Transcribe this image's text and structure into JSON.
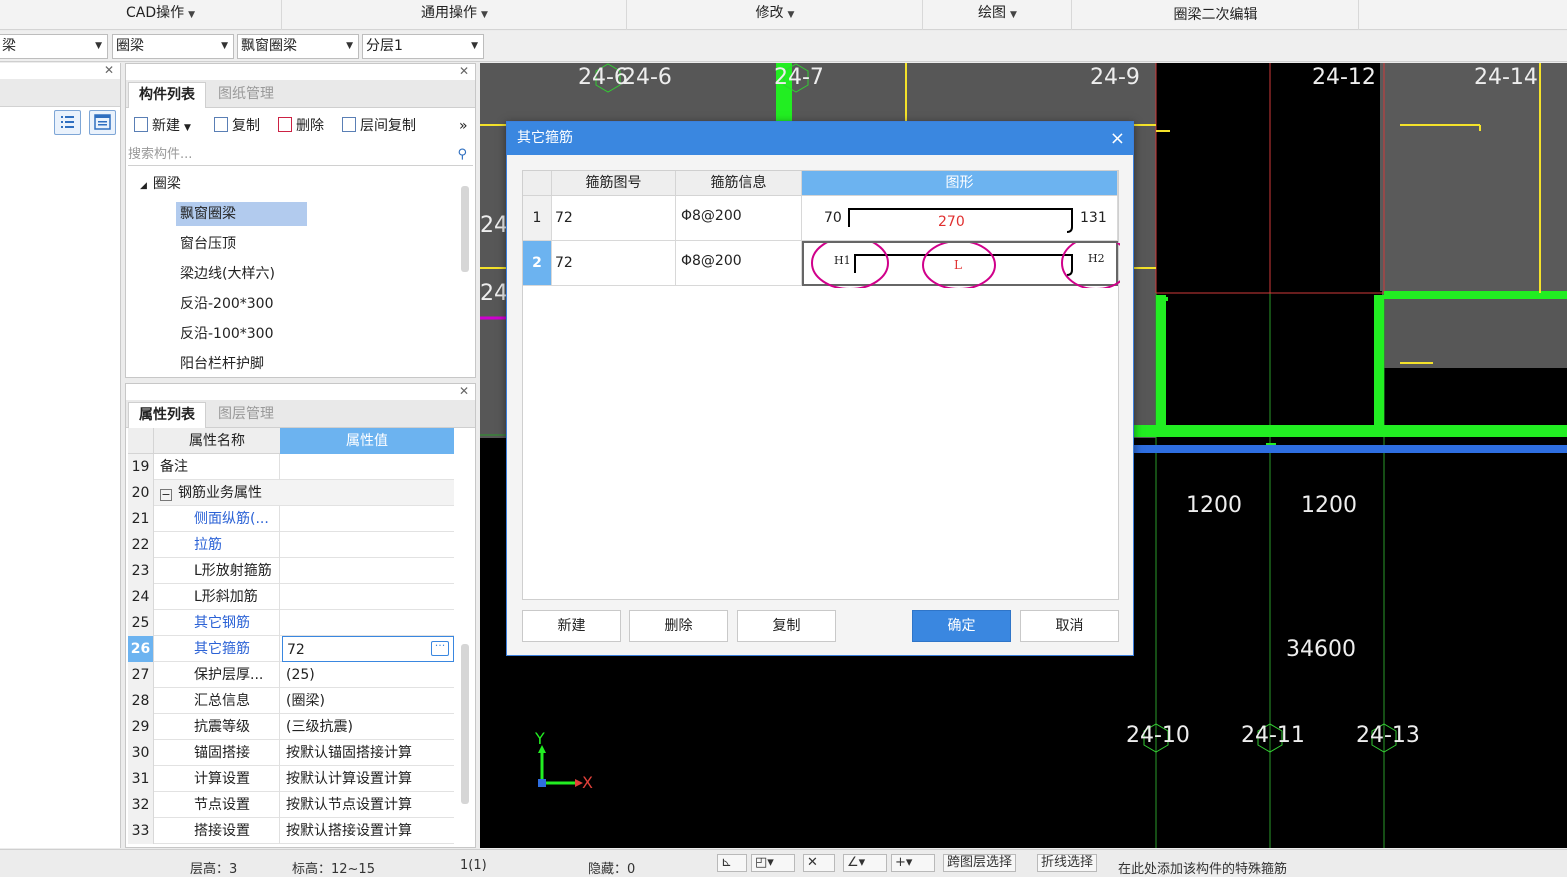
{
  "menubar": {
    "items": [
      "CAD操作",
      "通用操作",
      "修改",
      "绘图",
      "圈梁二次编辑"
    ]
  },
  "combos": {
    "c0": "梁",
    "c1": "圈梁",
    "c2": "飘窗圈梁",
    "c3": "分层1"
  },
  "component_panel": {
    "tabs": [
      "构件列表",
      "图纸管理"
    ],
    "toolbar": {
      "new": "新建",
      "copy": "复制",
      "delete": "删除",
      "floor_copy": "层间复制",
      "more": "»"
    },
    "search_placeholder": "搜索构件...",
    "tree_root": "圈梁",
    "tree_items": [
      "飘窗圈梁",
      "窗台压顶",
      "梁边线(大样六)",
      "反沿-200*300",
      "反沿-100*300",
      "阳台栏杆护脚"
    ]
  },
  "property_panel": {
    "tabs": [
      "属性列表",
      "图层管理"
    ],
    "col_name": "属性名称",
    "col_value": "属性值",
    "rows": [
      {
        "num": "19",
        "name": "备注",
        "value": ""
      },
      {
        "num": "20",
        "name": "钢筋业务属性",
        "value": ""
      },
      {
        "num": "21",
        "name": "侧面纵筋(...",
        "value": ""
      },
      {
        "num": "22",
        "name": "拉筋",
        "value": ""
      },
      {
        "num": "23",
        "name": "L形放射箍筋",
        "value": ""
      },
      {
        "num": "24",
        "name": "L形斜加筋",
        "value": ""
      },
      {
        "num": "25",
        "name": "其它钢筋",
        "value": ""
      },
      {
        "num": "26",
        "name": "其它箍筋",
        "value": "72"
      },
      {
        "num": "27",
        "name": "保护层厚...",
        "value": "(25)"
      },
      {
        "num": "28",
        "name": "汇总信息",
        "value": "(圈梁)"
      },
      {
        "num": "29",
        "name": "抗震等级",
        "value": "(三级抗震)"
      },
      {
        "num": "30",
        "name": "锚固搭接",
        "value": "按默认锚固搭接计算"
      },
      {
        "num": "31",
        "name": "计算设置",
        "value": "按默认计算设置计算"
      },
      {
        "num": "32",
        "name": "节点设置",
        "value": "按默认节点设置计算"
      },
      {
        "num": "33",
        "name": "搭接设置",
        "value": "按默认搭接设置计算"
      }
    ]
  },
  "canvas": {
    "axis_top": [
      "24-6",
      "24-6",
      "24-7",
      "24-9",
      "24-12",
      "24-14"
    ],
    "axis_left": [
      "24",
      "24"
    ],
    "dims": [
      "1200",
      "1200",
      "34600"
    ],
    "axis_bottom": [
      "24-10",
      "24-11",
      "24-13"
    ],
    "ucs_x": "X",
    "ucs_y": "Y"
  },
  "dialog": {
    "title": "其它箍筋",
    "close": "×",
    "headers": [
      "箍筋图号",
      "箍筋信息",
      "图形"
    ],
    "rows": [
      {
        "num": "1",
        "code": "72",
        "info": "Φ8@200",
        "left": "70",
        "middle": "270",
        "right": "131"
      },
      {
        "num": "2",
        "code": "72",
        "info": "Φ8@200",
        "left": "H1",
        "middle": "L",
        "right": "H2"
      }
    ],
    "buttons": {
      "new": "新建",
      "delete": "删除",
      "copy": "复制",
      "ok": "确定",
      "cancel": "取消"
    }
  },
  "statusbar": {
    "floor": "层高：3",
    "elevation": "标高：12~15",
    "page": "1(1)",
    "hidden": "隐藏：0",
    "layer_select": "跨图层选择",
    "polyline_select": "折线选择",
    "hint": "在此处添加该构件的特殊箍筋"
  },
  "colors": {
    "accent": "#3a87e0",
    "cad_green": "#22ee22",
    "cad_yellow": "#f4e22a",
    "cad_red": "#e0403a",
    "annotation_pink": "#d0008a"
  }
}
